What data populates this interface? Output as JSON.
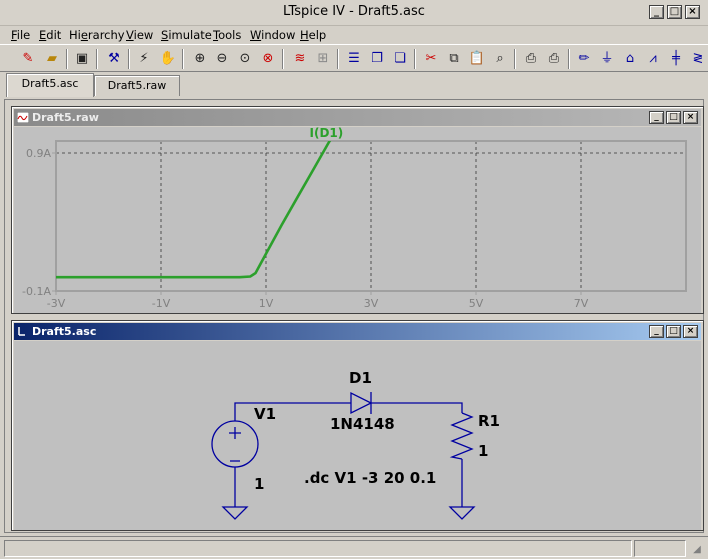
{
  "window": {
    "title": "LTspice IV - Draft5.asc",
    "controls": [
      "_",
      "□",
      "×"
    ]
  },
  "menu": [
    {
      "pre": "",
      "ul": "F",
      "post": "ile"
    },
    {
      "pre": "",
      "ul": "E",
      "post": "dit"
    },
    {
      "pre": "Hi",
      "ul": "e",
      "post": "rarchy"
    },
    {
      "pre": "",
      "ul": "V",
      "post": "iew"
    },
    {
      "pre": "",
      "ul": "S",
      "post": "imulate"
    },
    {
      "pre": "",
      "ul": "T",
      "post": "ools"
    },
    {
      "pre": "",
      "ul": "W",
      "post": "indow"
    },
    {
      "pre": "",
      "ul": "H",
      "post": "elp"
    }
  ],
  "toolbar_icons": [
    "new-schematic-icon",
    "open-icon",
    "save-icon",
    "control-panel-icon",
    "run-icon",
    "halt-icon",
    "zoom-in-icon",
    "zoom-out-icon",
    "zoom-fit-icon",
    "zoom-cancel-icon",
    "autorange-icon",
    "plot-settings-icon",
    "tile-horizontal-icon",
    "cascade-icon",
    "close-all-icon",
    "cut-icon",
    "copy-icon",
    "paste-icon",
    "find-icon",
    "print-setup-icon",
    "print-icon",
    "draw-wire-icon",
    "ground-icon",
    "label-net-icon",
    "resistor-icon",
    "capacitor-icon",
    "inductor-icon"
  ],
  "tabs": [
    {
      "label": "Draft5.asc",
      "active": true
    },
    {
      "label": "Draft5.raw",
      "active": false
    }
  ],
  "waveform": {
    "title": "Draft5.raw",
    "colors": {
      "trace": "#2ca02c",
      "grid": "#333333",
      "frame": "#a0a0a0",
      "axis_text": "#808080"
    }
  },
  "chart_data": {
    "type": "line",
    "series": [
      {
        "name": "I(D1)",
        "x": [
          -3.0,
          0.2,
          0.5,
          0.7,
          0.8,
          1.0,
          1.3,
          1.6,
          1.9,
          2.2,
          2.5
        ],
        "y": [
          0.0,
          0.0,
          0.0,
          0.005,
          0.03,
          0.17,
          0.38,
          0.58,
          0.78,
          0.98,
          1.15
        ]
      }
    ],
    "xlim": [
      -3,
      9
    ],
    "ylim": [
      -0.1,
      0.9
    ],
    "x_ticks": [
      {
        "v": -3,
        "label": "-3V"
      },
      {
        "v": -1,
        "label": "-1V"
      },
      {
        "v": 1,
        "label": "1V"
      },
      {
        "v": 3,
        "label": "3V"
      },
      {
        "v": 5,
        "label": "5V"
      },
      {
        "v": 7,
        "label": "7V"
      }
    ],
    "y_ticks": [
      {
        "v": -0.1,
        "label": "-0.1A"
      },
      {
        "v": 0.9,
        "label": "0.9A"
      }
    ],
    "grid": true,
    "xlabel": "",
    "ylabel": "",
    "title": ""
  },
  "schematic": {
    "title": "Draft5.asc",
    "diode": {
      "ref": "D1",
      "value": "1N4148"
    },
    "source": {
      "ref": "V1",
      "value": "1"
    },
    "resistor": {
      "ref": "R1",
      "value": "1"
    },
    "directive": ".dc V1 -3 20 0.1",
    "colors": {
      "wire": "#0000a0",
      "text": "#000000",
      "background": "#c0c0c0"
    }
  }
}
